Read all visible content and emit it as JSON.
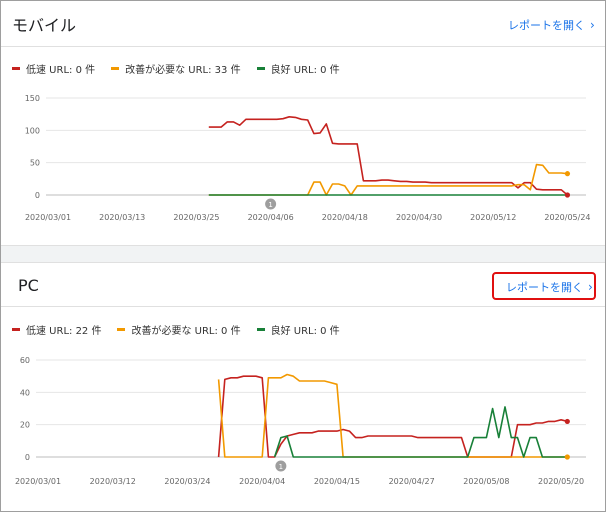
{
  "mobile": {
    "title": "モバイル",
    "report_link": "レポートを開く",
    "legend": [
      {
        "label": "低速 URL: 0 件",
        "color": "#c5221f"
      },
      {
        "label": "改善が必要な URL: 33 件",
        "color": "#f29900"
      },
      {
        "label": "良好 URL: 0 件",
        "color": "#188038"
      }
    ]
  },
  "pc": {
    "title": "PC",
    "report_link": "レポートを開く",
    "legend": [
      {
        "label": "低速 URL: 22 件",
        "color": "#c5221f"
      },
      {
        "label": "改善が必要な URL: 0 件",
        "color": "#f29900"
      },
      {
        "label": "良好 URL: 0 件",
        "color": "#188038"
      }
    ]
  },
  "chart_data": [
    {
      "type": "line",
      "yticks": [
        0,
        50,
        100,
        150
      ],
      "ylim": [
        0,
        150
      ],
      "x_tick_labels": [
        "2020/03/01",
        "2020/03/13",
        "2020/03/25",
        "2020/04/06",
        "2020/04/18",
        "2020/04/30",
        "2020/05/12",
        "2020/05/24"
      ],
      "annotation": {
        "label": "1",
        "x": 36
      },
      "series": [
        {
          "color": "#c5221f",
          "points": [
            [
              0,
              null
            ],
            [
              26,
              105
            ],
            [
              27,
              105
            ],
            [
              28,
              105
            ],
            [
              29,
              113
            ],
            [
              30,
              113
            ],
            [
              31,
              108
            ],
            [
              32,
              117
            ],
            [
              33,
              117
            ],
            [
              34,
              117
            ],
            [
              35,
              117
            ],
            [
              36,
              117
            ],
            [
              37,
              117
            ],
            [
              38,
              118
            ],
            [
              39,
              121
            ],
            [
              40,
              120
            ],
            [
              41,
              117
            ],
            [
              42,
              116
            ],
            [
              43,
              95
            ],
            [
              44,
              96
            ],
            [
              45,
              110
            ],
            [
              46,
              80
            ],
            [
              47,
              79
            ],
            [
              48,
              79
            ],
            [
              49,
              79
            ],
            [
              50,
              79
            ],
            [
              51,
              22
            ],
            [
              52,
              22
            ],
            [
              53,
              22
            ],
            [
              54,
              23
            ],
            [
              55,
              23
            ],
            [
              56,
              22
            ],
            [
              57,
              21
            ],
            [
              58,
              21
            ],
            [
              59,
              20
            ],
            [
              60,
              20
            ],
            [
              61,
              20
            ],
            [
              62,
              19
            ],
            [
              63,
              19
            ],
            [
              64,
              19
            ],
            [
              65,
              19
            ],
            [
              66,
              19
            ],
            [
              67,
              19
            ],
            [
              68,
              19
            ],
            [
              69,
              19
            ],
            [
              70,
              19
            ],
            [
              71,
              19
            ],
            [
              72,
              19
            ],
            [
              73,
              19
            ],
            [
              74,
              19
            ],
            [
              75,
              19
            ],
            [
              76,
              11
            ],
            [
              77,
              19
            ],
            [
              78,
              19
            ],
            [
              79,
              9
            ],
            [
              80,
              8
            ],
            [
              81,
              8
            ],
            [
              82,
              8
            ],
            [
              83,
              8
            ],
            [
              84,
              0
            ]
          ]
        },
        {
          "color": "#f29900",
          "points": [
            [
              26,
              0
            ],
            [
              27,
              0
            ],
            [
              28,
              0
            ],
            [
              29,
              0
            ],
            [
              30,
              0
            ],
            [
              31,
              0
            ],
            [
              32,
              0
            ],
            [
              33,
              0
            ],
            [
              34,
              0
            ],
            [
              35,
              0
            ],
            [
              36,
              0
            ],
            [
              37,
              0
            ],
            [
              38,
              0
            ],
            [
              39,
              0
            ],
            [
              40,
              0
            ],
            [
              41,
              0
            ],
            [
              42,
              0
            ],
            [
              43,
              20
            ],
            [
              44,
              20
            ],
            [
              45,
              0
            ],
            [
              46,
              17
            ],
            [
              47,
              17
            ],
            [
              48,
              14
            ],
            [
              49,
              0
            ],
            [
              50,
              14
            ],
            [
              51,
              14
            ],
            [
              52,
              14
            ],
            [
              53,
              14
            ],
            [
              54,
              14
            ],
            [
              55,
              14
            ],
            [
              56,
              14
            ],
            [
              57,
              14
            ],
            [
              58,
              14
            ],
            [
              59,
              14
            ],
            [
              60,
              14
            ],
            [
              61,
              14
            ],
            [
              62,
              14
            ],
            [
              63,
              14
            ],
            [
              64,
              14
            ],
            [
              65,
              14
            ],
            [
              66,
              14
            ],
            [
              67,
              14
            ],
            [
              68,
              14
            ],
            [
              69,
              14
            ],
            [
              70,
              14
            ],
            [
              71,
              14
            ],
            [
              72,
              14
            ],
            [
              73,
              14
            ],
            [
              74,
              14
            ],
            [
              75,
              14
            ],
            [
              76,
              16
            ],
            [
              77,
              16
            ],
            [
              78,
              8
            ],
            [
              79,
              47
            ],
            [
              80,
              46
            ],
            [
              81,
              34
            ],
            [
              82,
              34
            ],
            [
              83,
              34
            ],
            [
              84,
              33
            ]
          ]
        },
        {
          "color": "#188038",
          "points": [
            [
              26,
              0
            ],
            [
              84,
              0
            ]
          ]
        }
      ]
    },
    {
      "type": "line",
      "yticks": [
        0,
        20,
        40,
        60
      ],
      "ylim": [
        0,
        60
      ],
      "x_tick_labels": [
        "2020/03/01",
        "2020/03/12",
        "2020/03/24",
        "2020/04/04",
        "2020/04/15",
        "2020/04/27",
        "2020/05/08",
        "2020/05/20"
      ],
      "annotation": {
        "label": "1",
        "x": 39
      },
      "series": [
        {
          "color": "#c5221f",
          "points": [
            [
              29,
              0
            ],
            [
              30,
              48
            ],
            [
              31,
              49
            ],
            [
              32,
              49
            ],
            [
              33,
              50
            ],
            [
              34,
              50
            ],
            [
              35,
              50
            ],
            [
              36,
              49
            ],
            [
              37,
              0
            ],
            [
              38,
              0
            ],
            [
              39,
              8
            ],
            [
              40,
              13
            ],
            [
              41,
              14
            ],
            [
              42,
              15
            ],
            [
              43,
              15
            ],
            [
              44,
              15
            ],
            [
              45,
              16
            ],
            [
              46,
              16
            ],
            [
              47,
              16
            ],
            [
              48,
              16
            ],
            [
              49,
              17
            ],
            [
              50,
              16
            ],
            [
              51,
              12
            ],
            [
              52,
              12
            ],
            [
              53,
              13
            ],
            [
              54,
              13
            ],
            [
              55,
              13
            ],
            [
              56,
              13
            ],
            [
              57,
              13
            ],
            [
              58,
              13
            ],
            [
              59,
              13
            ],
            [
              60,
              13
            ],
            [
              61,
              12
            ],
            [
              62,
              12
            ],
            [
              63,
              12
            ],
            [
              64,
              12
            ],
            [
              65,
              12
            ],
            [
              66,
              12
            ],
            [
              67,
              12
            ],
            [
              68,
              12
            ],
            [
              69,
              0
            ],
            [
              70,
              0
            ],
            [
              71,
              0
            ],
            [
              72,
              0
            ],
            [
              73,
              0
            ],
            [
              74,
              0
            ],
            [
              75,
              0
            ],
            [
              76,
              0
            ],
            [
              77,
              20
            ],
            [
              78,
              20
            ],
            [
              79,
              20
            ],
            [
              80,
              21
            ],
            [
              81,
              21
            ],
            [
              82,
              22
            ],
            [
              83,
              22
            ],
            [
              84,
              23
            ],
            [
              85,
              22
            ]
          ]
        },
        {
          "color": "#f29900",
          "points": [
            [
              29,
              48
            ],
            [
              30,
              0
            ],
            [
              31,
              0
            ],
            [
              32,
              0
            ],
            [
              33,
              0
            ],
            [
              34,
              0
            ],
            [
              35,
              0
            ],
            [
              36,
              0
            ],
            [
              37,
              49
            ],
            [
              38,
              49
            ],
            [
              39,
              49
            ],
            [
              40,
              51
            ],
            [
              41,
              50
            ],
            [
              42,
              47
            ],
            [
              43,
              47
            ],
            [
              44,
              47
            ],
            [
              45,
              47
            ],
            [
              46,
              47
            ],
            [
              47,
              46
            ],
            [
              48,
              45
            ],
            [
              49,
              0
            ],
            [
              50,
              0
            ],
            [
              85,
              0
            ]
          ]
        },
        {
          "color": "#188038",
          "points": [
            [
              38,
              0
            ],
            [
              39,
              12
            ],
            [
              40,
              13
            ],
            [
              41,
              0
            ],
            [
              69,
              0
            ],
            [
              70,
              12
            ],
            [
              71,
              12
            ],
            [
              72,
              12
            ],
            [
              73,
              30
            ],
            [
              74,
              12
            ],
            [
              75,
              31
            ],
            [
              76,
              12
            ],
            [
              77,
              12
            ],
            [
              78,
              0
            ],
            [
              79,
              12
            ],
            [
              80,
              12
            ],
            [
              81,
              0
            ],
            [
              85,
              0
            ]
          ]
        }
      ]
    }
  ]
}
